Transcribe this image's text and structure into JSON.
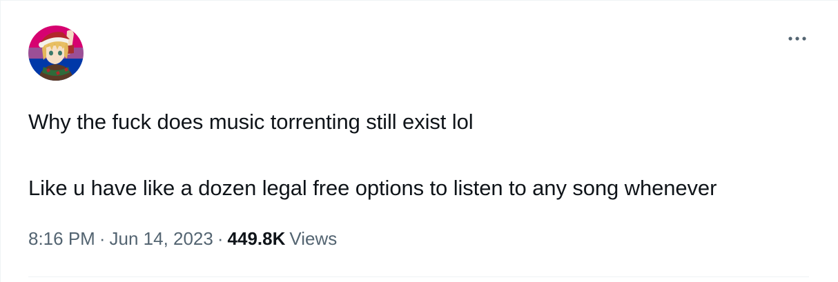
{
  "tweet": {
    "text_line_1": "Why the fuck does music torrenting still exist lol",
    "text_line_2": "Like u have like a dozen legal free options to listen to any song whenever",
    "time": "8:16 PM",
    "separator": "·",
    "date": "Jun 14, 2023",
    "views_count": "449.8K",
    "views_label": "Views"
  },
  "icons": {
    "more": "more-horizontal-icon",
    "avatar": "profile-avatar-anime-character"
  },
  "colors": {
    "text_primary": "#0f1419",
    "text_secondary": "#536471",
    "border": "#eff3f4",
    "avatar_flag_pink": "#d60270",
    "avatar_flag_purple": "#9b4f96",
    "avatar_flag_blue": "#0038a8"
  }
}
